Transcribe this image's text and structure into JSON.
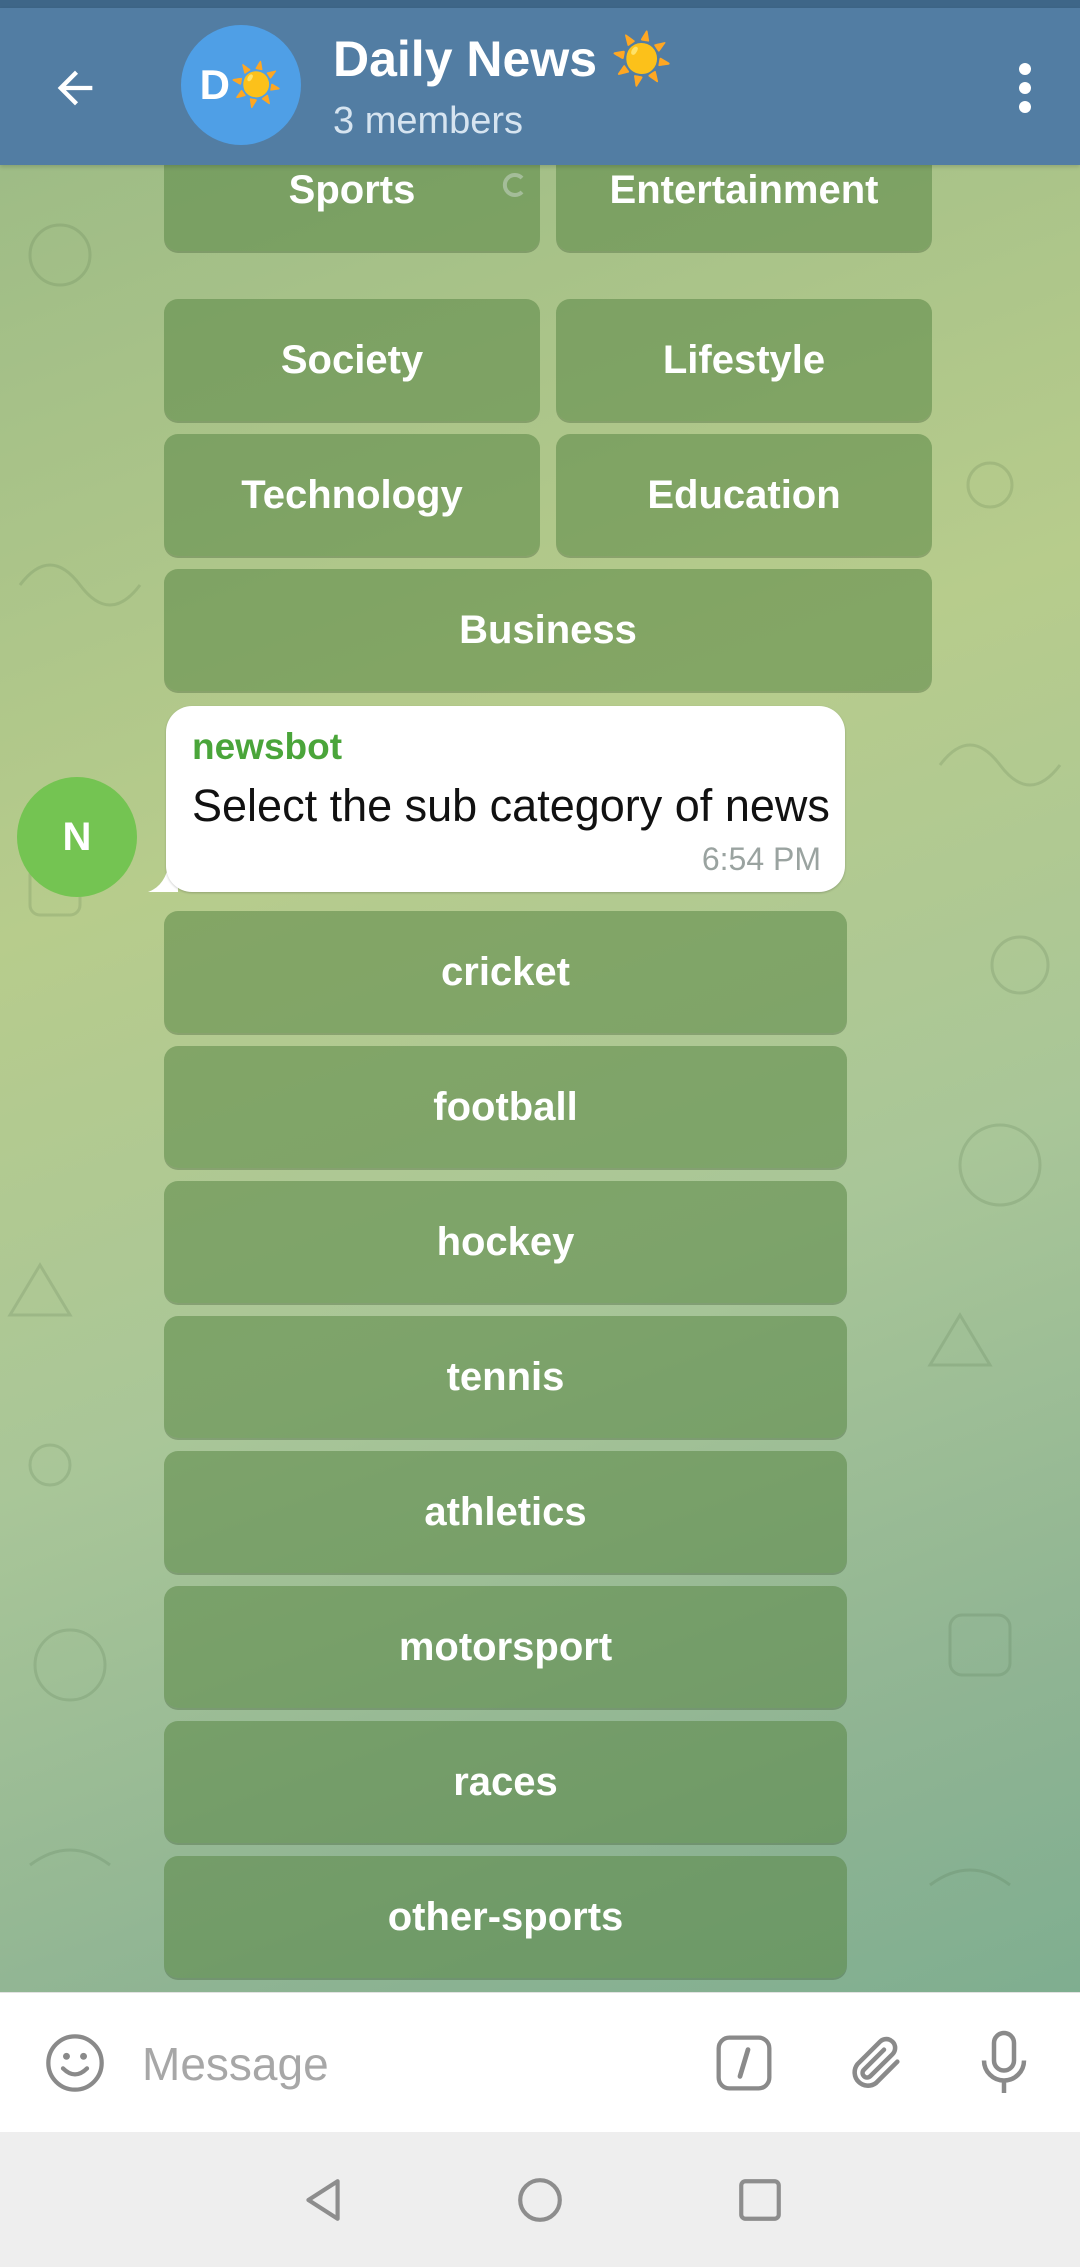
{
  "header": {
    "title": "Daily News ☀️",
    "subtitle": "3 members",
    "avatar_text": "D☀️",
    "back_icon": "arrow-left-icon",
    "menu_icon": "more-vertical-icon"
  },
  "category_keyboard": [
    {
      "label": "Sports"
    },
    {
      "label": "Entertainment"
    },
    {
      "label": "Society"
    },
    {
      "label": "Lifestyle"
    },
    {
      "label": "Technology"
    },
    {
      "label": "Education"
    },
    {
      "label": "Business"
    }
  ],
  "message": {
    "sender": "newsbot",
    "text": "Select the sub category of news",
    "time": "6:54 PM",
    "avatar_letter": "N"
  },
  "subcategory_keyboard": [
    {
      "label": "cricket"
    },
    {
      "label": "football"
    },
    {
      "label": "hockey"
    },
    {
      "label": "tennis"
    },
    {
      "label": "athletics"
    },
    {
      "label": "motorsport"
    },
    {
      "label": "races"
    },
    {
      "label": "other-sports"
    }
  ],
  "composer": {
    "placeholder": "Message",
    "emoji_icon": "smile-icon",
    "command_icon": "slash-command-icon",
    "attach_icon": "paperclip-icon",
    "mic_icon": "microphone-icon"
  },
  "colors": {
    "header_bg": "#527da3",
    "button_bg": "rgba(90,135,70,0.55)",
    "sender_color": "#4aa53a",
    "bot_avatar": "#74c452",
    "group_avatar": "#4f9fe6"
  }
}
